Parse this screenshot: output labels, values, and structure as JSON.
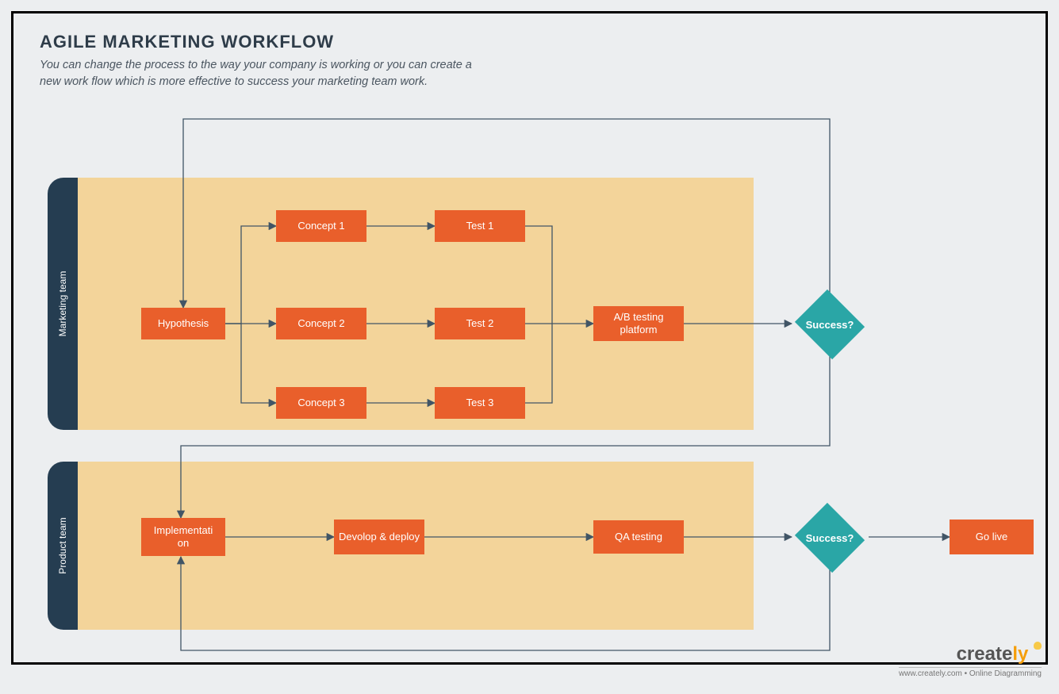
{
  "header": {
    "title": "AGILE MARKETING WORKFLOW",
    "subtitle": "You can change the process to the way your company is working or you can create a new work flow which is more effective to success your marketing team work."
  },
  "lanes": {
    "marketing": {
      "label": "Marketing team"
    },
    "product": {
      "label": "Product team"
    }
  },
  "nodes": {
    "hypothesis": "Hypothesis",
    "concept1": "Concept 1",
    "concept2": "Concept 2",
    "concept3": "Concept 3",
    "test1": "Test 1",
    "test2": "Test 2",
    "test3": "Test 3",
    "ab": "A/B testing platform",
    "success1": "Success?",
    "implementation": "Implementati\non",
    "devdeploy": "Devolop & deploy",
    "qa": "QA testing",
    "success2": "Success?",
    "golive": "Go live"
  },
  "footer": {
    "brand_a": "create",
    "brand_b": "ly",
    "tagline": "www.creately.com • Online Diagramming"
  },
  "colors": {
    "process": "#e95f2b",
    "decision": "#2aa6a6",
    "lane_tab": "#253d51",
    "lane_body": "#f3d49a",
    "connector": "#415566"
  }
}
